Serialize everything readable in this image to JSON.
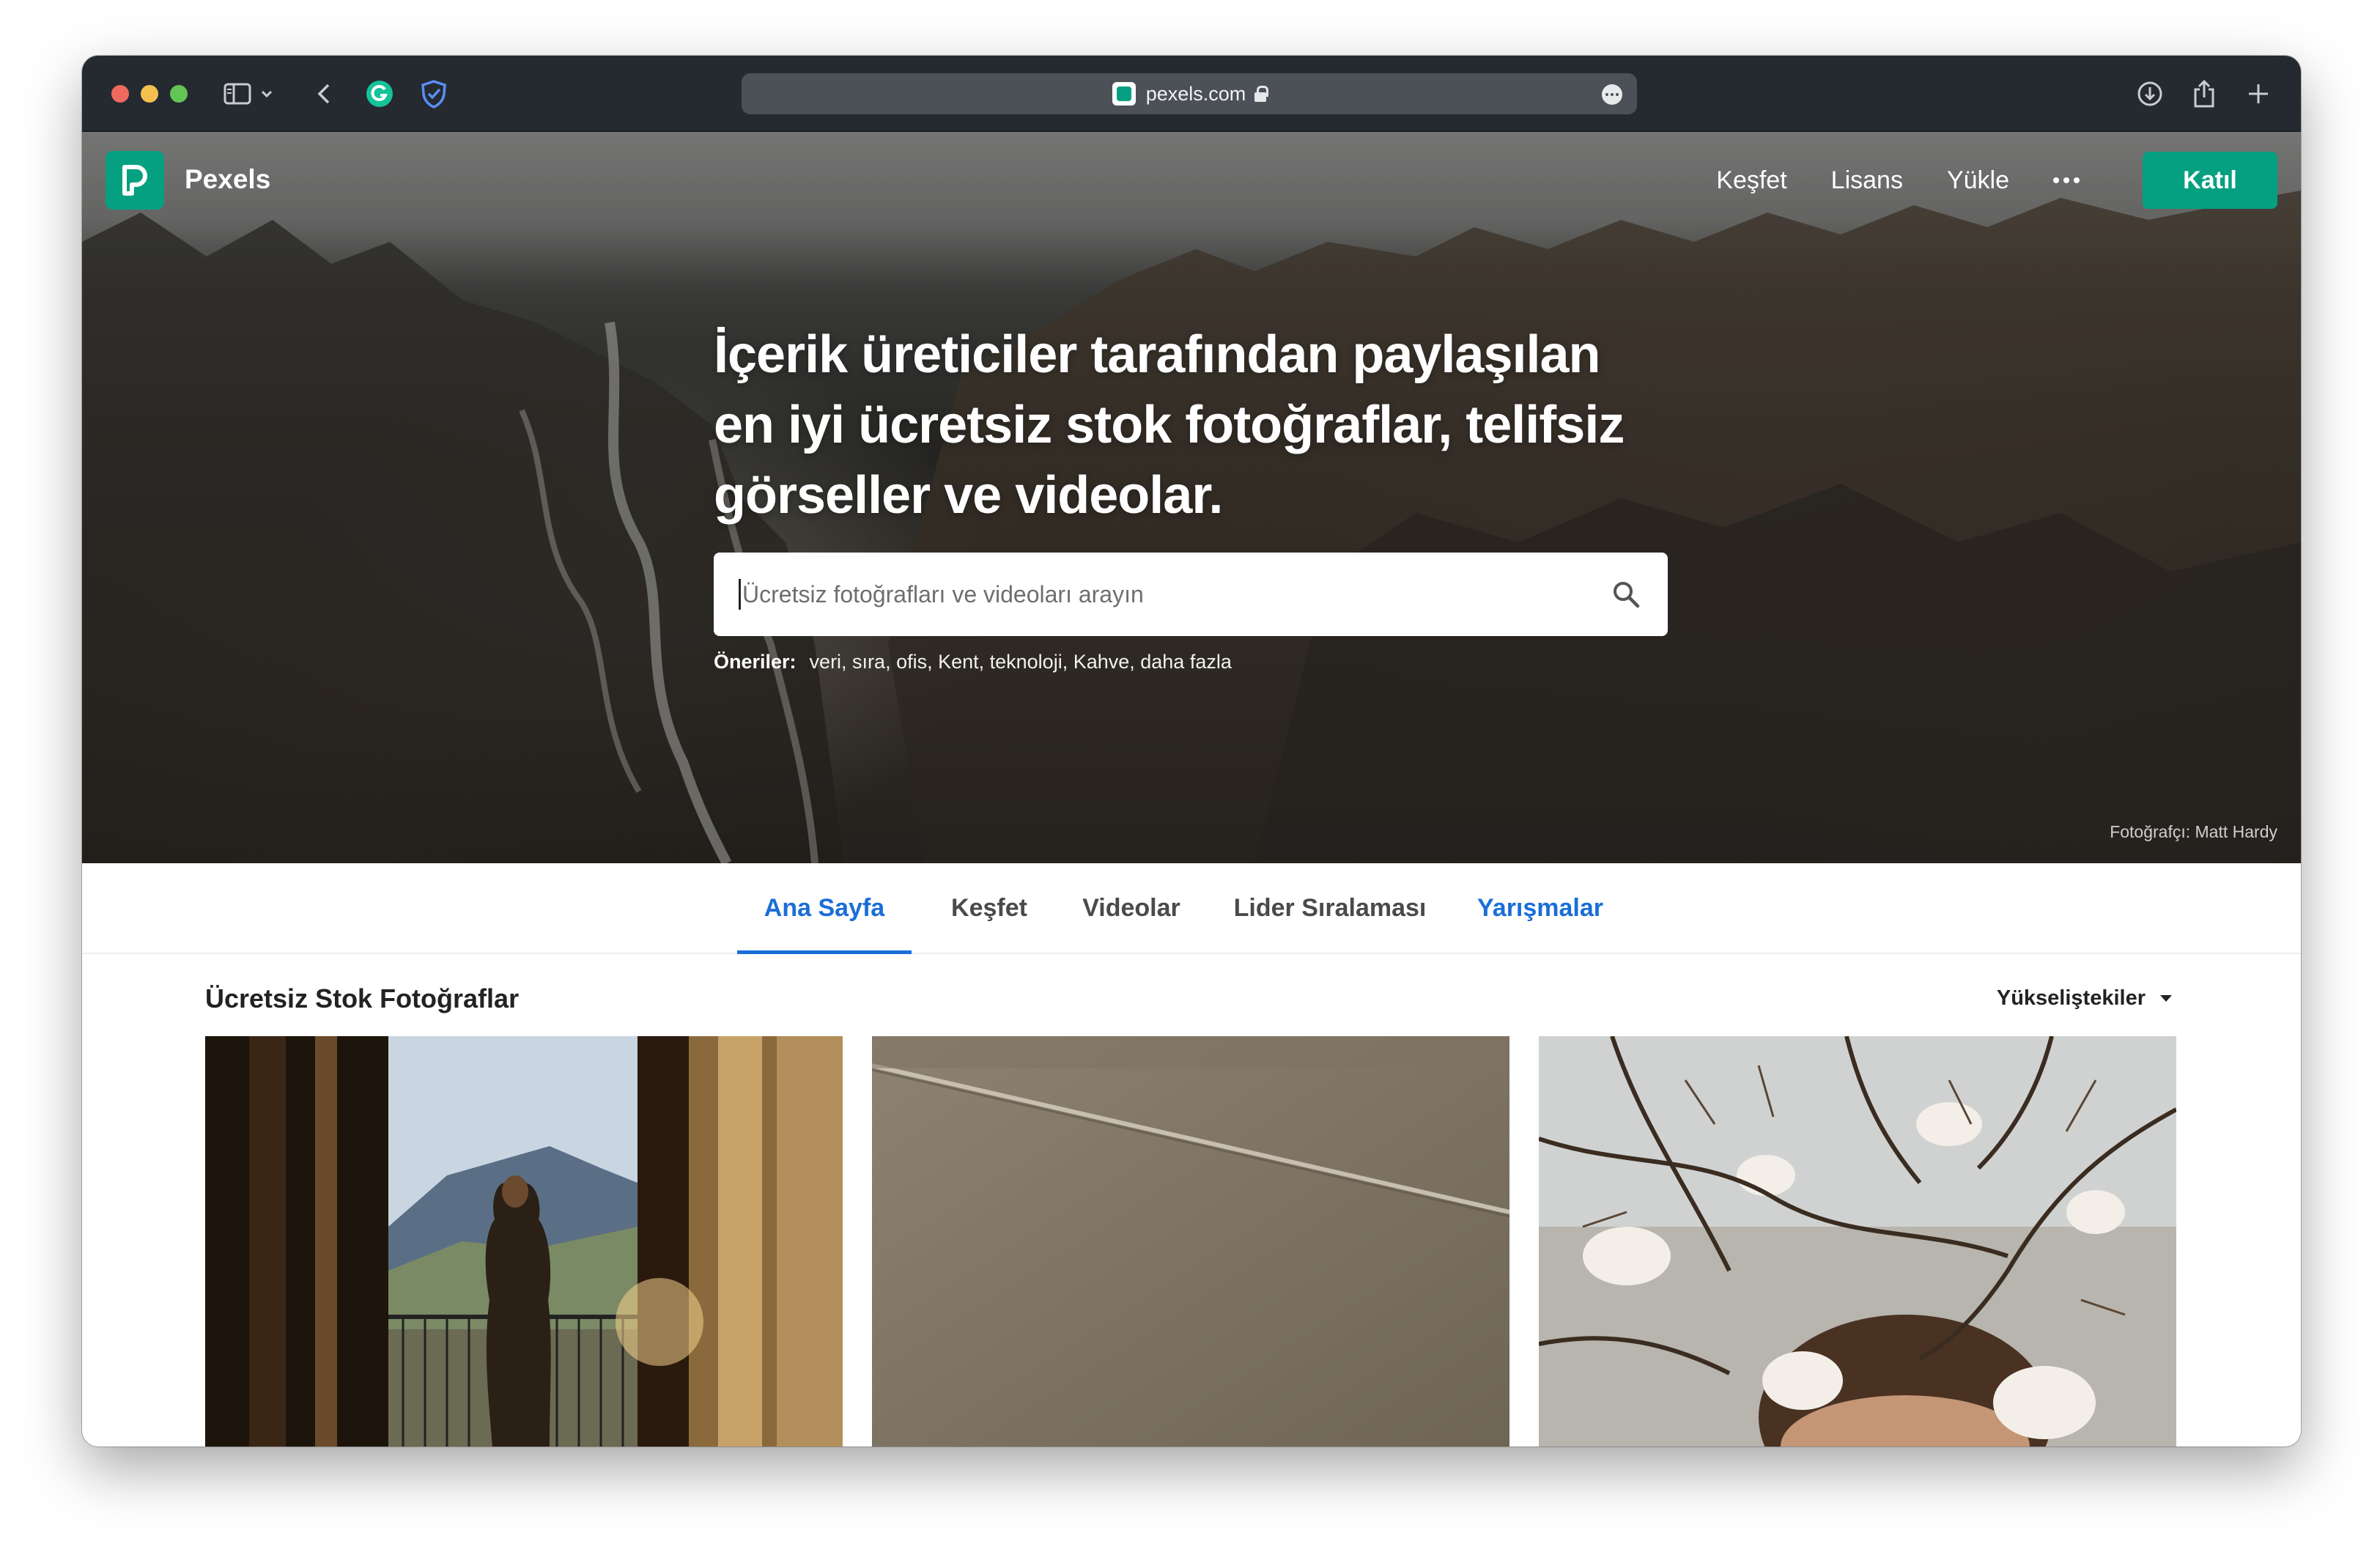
{
  "browser": {
    "url": "pexels.com",
    "colors": {
      "toolbar": "#252a31",
      "address_bar": "#4c5158"
    },
    "icons": [
      "sidebar-icon",
      "chevron-down-icon",
      "back-icon",
      "grammarly-icon",
      "privacy-shield-icon",
      "download-icon",
      "share-icon",
      "new-tab-icon",
      "more-icon"
    ]
  },
  "nav": {
    "brand": "Pexels",
    "links": [
      "Keşfet",
      "Lisans",
      "Yükle"
    ],
    "join_label": "Katıl",
    "brand_color": "#05a081"
  },
  "hero": {
    "headline_lines": [
      "İçerik üreticiler tarafından paylaşılan",
      "en iyi ücretsiz stok fotoğraflar, telifsiz",
      "görseller ve videolar."
    ],
    "search_placeholder": "Ücretsiz fotoğrafları ve videoları arayın",
    "suggestions_label": "Öneriler:",
    "suggestions": "veri, sıra, ofis, Kent, teknoloji, Kahve, daha fazla",
    "photo_credit": "Fotoğrafçı: Matt Hardy"
  },
  "tabs": [
    {
      "label": "Ana Sayfa",
      "active": true
    },
    {
      "label": "Keşfet",
      "active": false
    },
    {
      "label": "Videolar",
      "active": false
    },
    {
      "label": "Lider Sıralaması",
      "active": false
    },
    {
      "label": "Yarışmalar",
      "active": false
    }
  ],
  "content": {
    "section_title": "Ücretsiz Stok Fotoğraflar",
    "sort_value": "Yükseliştekiler",
    "accent_color": "#1a6ed8"
  }
}
